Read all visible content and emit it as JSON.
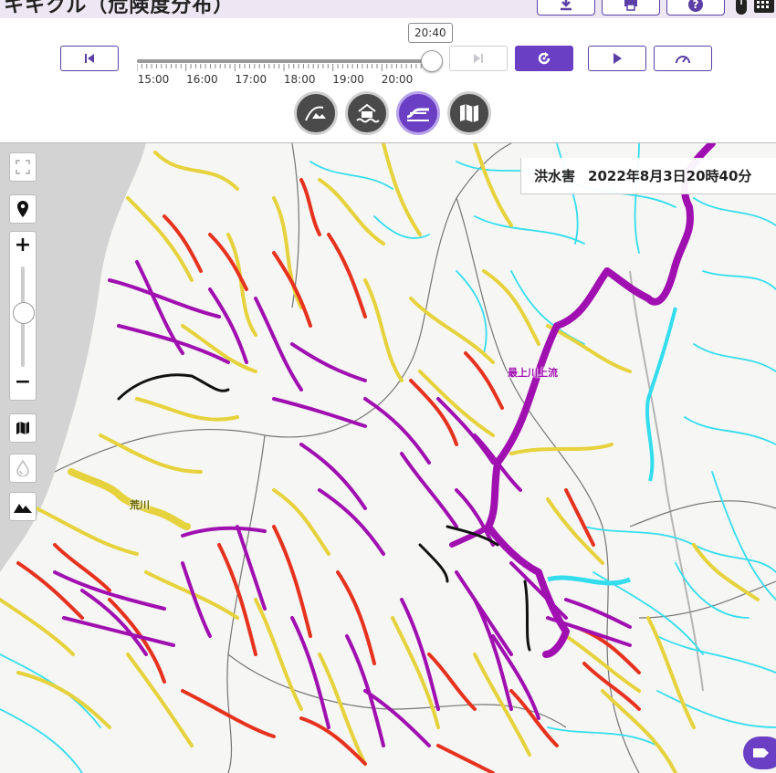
{
  "header": {
    "title": "キキクル（危険度分布）",
    "icons": [
      "download-icon",
      "print-icon",
      "help-icon",
      "mouse-icon",
      "keyboard-icon"
    ]
  },
  "timeline": {
    "current_time": "20:40",
    "progress": 1.0,
    "tick_labels": [
      "15:00",
      "16:00",
      "17:00",
      "18:00",
      "19:00",
      "20:00"
    ],
    "buttons": [
      "skip-to-start",
      "skip-to-end",
      "refresh",
      "play",
      "speed"
    ]
  },
  "layers": [
    "landslide-layer",
    "flood-inundation-layer",
    "flood-layer",
    "map-layer"
  ],
  "active_layer": "flood-layer",
  "map": {
    "info": {
      "type": "洪水害",
      "datetime": "2022年8月3日20時40分"
    },
    "river_labels": {
      "mogami": "最上川上流",
      "ara": "荒川"
    },
    "zoom_in": "+",
    "zoom_out": "−",
    "zoom_level_fraction": 0.45
  },
  "colors": {
    "accent": "#6a3fc4",
    "purple_risk": "#a010b0",
    "red_risk": "#e6321e",
    "yellow_risk": "#e6d23c",
    "cyan_normal": "#33ddee",
    "black_extreme": "#111111"
  }
}
